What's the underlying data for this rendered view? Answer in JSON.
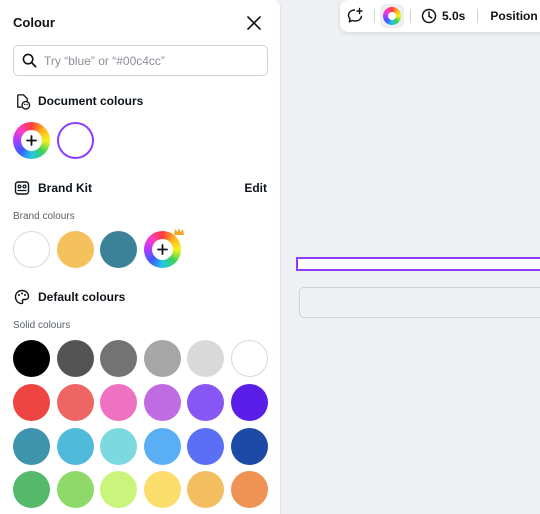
{
  "panel": {
    "title": "Colour",
    "search_placeholder": "Try “blue” or “#00c4cc”"
  },
  "document_colours": {
    "title": "Document colours",
    "swatches": [
      {
        "kind": "add-colour",
        "icon": "plus-icon"
      },
      {
        "kind": "colour",
        "color": "#ffffff",
        "selected": true
      }
    ]
  },
  "brand_kit": {
    "title": "Brand Kit",
    "edit_label": "Edit",
    "sublabel": "Brand colours",
    "swatches": [
      "#ffffff",
      "#f5c15d",
      "#3b8198"
    ],
    "add_icon": "plus-icon",
    "badge_icon": "crown-icon"
  },
  "default_colours": {
    "title": "Default colours",
    "sublabel": "Solid colours",
    "rows": [
      [
        "#000000",
        "#545454",
        "#737373",
        "#a6a6a6",
        "#d9d9d9",
        "#ffffff"
      ],
      [
        "#ee4543",
        "#ed6663",
        "#ee71c2",
        "#bf6ce3",
        "#8756f5",
        "#5b1ee8"
      ],
      [
        "#3e93ad",
        "#4fbad9",
        "#7dd9e0",
        "#5aaef4",
        "#5b6ef6",
        "#1c4aa6"
      ],
      [
        "#55b86b",
        "#8fd96a",
        "#c9f57c",
        "#fcdc6b",
        "#f3be60",
        "#ef9355"
      ]
    ]
  },
  "toolbar": {
    "comment_icon": "add-comment-icon",
    "color_icon": "color-wheel-icon",
    "timer_icon": "clock-icon",
    "duration": "5.0s",
    "position_label": "Position"
  },
  "colors": {
    "accent": "#8b3dff",
    "panel_bg": "#ffffff",
    "canvas_bg": "#eef0f4"
  }
}
